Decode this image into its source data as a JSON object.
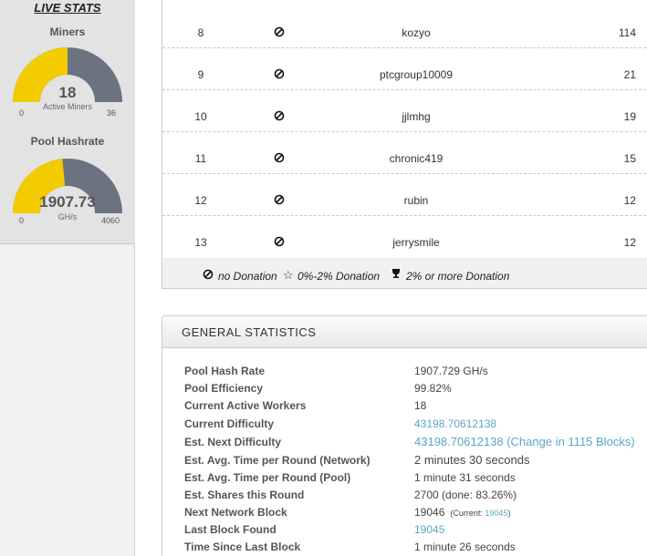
{
  "sidebar": {
    "title": "LIVE STATS",
    "gauges": [
      {
        "label": "Miners",
        "value": "18",
        "unit": "Active Miners",
        "min": "0",
        "max": "36",
        "fraction": 0.5
      },
      {
        "label": "Pool Hashrate",
        "value": "1907.73",
        "unit": "GH/s",
        "min": "0",
        "max": "4060",
        "fraction": 0.47
      }
    ]
  },
  "contributors": {
    "rows": [
      {
        "rank": "8",
        "name": "kozyo",
        "value": "114"
      },
      {
        "rank": "9",
        "name": "ptcgroup10009",
        "value": "21"
      },
      {
        "rank": "10",
        "name": "jjlmhg",
        "value": "19"
      },
      {
        "rank": "11",
        "name": "chronic419",
        "value": "15"
      },
      {
        "rank": "12",
        "name": "rubin",
        "value": "12"
      },
      {
        "rank": "13",
        "name": "jerrysmile",
        "value": "12"
      }
    ],
    "legend": {
      "no_donation": "no Donation",
      "partial_donation": "0%-2% Donation",
      "high_donation": "2% or more Donation"
    }
  },
  "general_statistics": {
    "title": "GENERAL STATISTICS",
    "rows": [
      {
        "label": "Pool Hash Rate",
        "value": "1907.729 GH/s"
      },
      {
        "label": "Pool Efficiency",
        "value": "99.82%"
      },
      {
        "label": "Current Active Workers",
        "value": "18"
      },
      {
        "label": "Current Difficulty",
        "value": "43198.70612138"
      },
      {
        "label": "Est. Next Difficulty",
        "value": "43198.70612138 (Change in 1115 Blocks)"
      },
      {
        "label": "Est. Avg. Time per Round (Network)",
        "value": "2 minutes 30 seconds"
      },
      {
        "label": "Est. Avg. Time per Round (Pool)",
        "value": "1 minute 31 seconds"
      },
      {
        "label": "Est. Shares this Round",
        "value": "2700 (done: 83.26%)"
      },
      {
        "label": "Next Network Block",
        "value": "19046",
        "sub_label": "(Current:",
        "sub_link": "19045",
        "sub_close": ")"
      },
      {
        "label": "Last Block Found",
        "value": "19045"
      },
      {
        "label": "Time Since Last Block",
        "value": "1 minute 26 seconds"
      }
    ]
  },
  "colors": {
    "gauge_fill": "#f2cc00",
    "gauge_track": "#6b7380",
    "link": "#5aa6c4"
  },
  "icons": {
    "no_donation": "no-donation-icon",
    "partial_donation": "star-icon",
    "high_donation": "trophy-icon"
  }
}
